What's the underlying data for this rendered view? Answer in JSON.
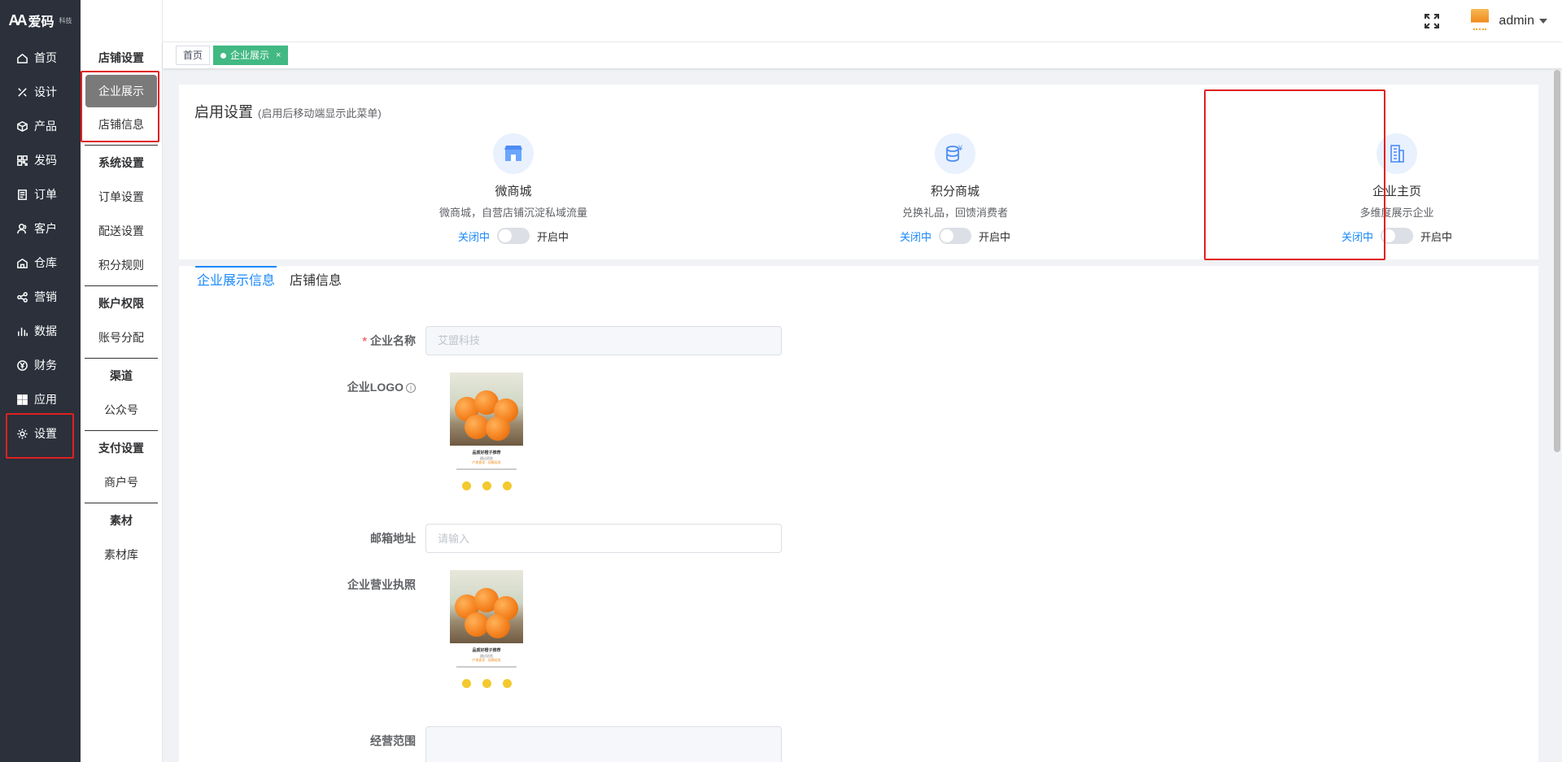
{
  "logo": {
    "text": "爱码",
    "sub": "科技"
  },
  "sidebar": {
    "items": [
      {
        "label": "首页",
        "icon": "home-icon"
      },
      {
        "label": "设计",
        "icon": "design-icon"
      },
      {
        "label": "产品",
        "icon": "box-icon"
      },
      {
        "label": "发码",
        "icon": "qrcode-icon"
      },
      {
        "label": "订单",
        "icon": "order-icon"
      },
      {
        "label": "客户",
        "icon": "customer-icon"
      },
      {
        "label": "仓库",
        "icon": "warehouse-icon"
      },
      {
        "label": "营销",
        "icon": "share-icon"
      },
      {
        "label": "数据",
        "icon": "bar-chart-icon"
      },
      {
        "label": "财务",
        "icon": "yen-icon"
      },
      {
        "label": "应用",
        "icon": "apps-icon"
      },
      {
        "label": "设置",
        "icon": "gear-icon"
      }
    ]
  },
  "submenu": {
    "groups": [
      {
        "title": "店铺设置",
        "items": [
          "企业展示",
          "店铺信息"
        ]
      },
      {
        "title": "系统设置",
        "items": [
          "订单设置",
          "配送设置",
          "积分规则"
        ]
      },
      {
        "title": "账户权限",
        "items": [
          "账号分配"
        ]
      },
      {
        "title": "渠道",
        "items": [
          "公众号"
        ]
      },
      {
        "title": "支付设置",
        "items": [
          "商户号"
        ]
      },
      {
        "title": "素材",
        "items": [
          "素材库"
        ]
      }
    ]
  },
  "header": {
    "username": "admin"
  },
  "tags": [
    {
      "label": "首页"
    },
    {
      "label": "企业展示",
      "close": "×"
    }
  ],
  "enable_settings": {
    "title": "启用设置",
    "hint": "(启用后移动端显示此菜单)",
    "modules": [
      {
        "name": "微商城",
        "desc": "微商城，自营店铺沉淀私域流量",
        "off": "关闭中",
        "on": "开启中",
        "enabled": false
      },
      {
        "name": "积分商城",
        "desc": "兑换礼品，回馈消费者",
        "off": "关闭中",
        "on": "开启中",
        "enabled": false
      },
      {
        "name": "企业主页",
        "desc": "多维度展示企业",
        "off": "关闭中",
        "on": "开启中",
        "enabled": false
      }
    ]
  },
  "tabs": [
    "企业展示信息",
    "店铺信息"
  ],
  "form": {
    "company_name": {
      "label": "企业名称",
      "required": "*",
      "value": "艾盟科技"
    },
    "logo": {
      "label": "企业LOGO",
      "info": "i"
    },
    "email": {
      "label": "邮箱地址",
      "placeholder": "请输入"
    },
    "license": {
      "label": "企业营业执照"
    },
    "scope": {
      "label": "经营范围"
    }
  },
  "poster": {
    "title": "品质好橙子推荐",
    "line2": "甜过初恋",
    "line3": "产地直发 · 现摘现发"
  },
  "colors": {
    "sidebar": "#2b303b",
    "accent": "#1989fa",
    "tag_active": "#42b983",
    "highlight": "#e02020"
  }
}
